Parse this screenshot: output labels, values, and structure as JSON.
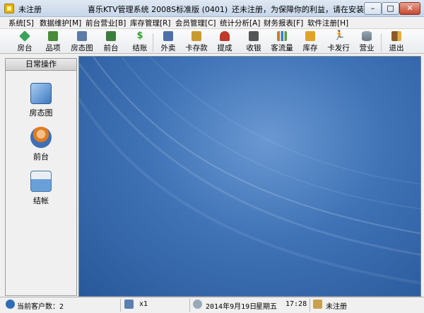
{
  "titlebar": {
    "left_text": "未注册",
    "app_title": "喜乐KTV管理系统  2008S标准版 (0401)",
    "notice": "还未注册，为保障你的利益，请在安装...",
    "min_label": "–",
    "max_label": "□",
    "close_label": "✕"
  },
  "menu": {
    "items": [
      {
        "label": "系统[S]"
      },
      {
        "label": "数据维护[M]"
      },
      {
        "label": "前台营业[B]"
      },
      {
        "label": "库存管理[R]"
      },
      {
        "label": "会员管理[C]"
      },
      {
        "label": "统计分析[A]"
      },
      {
        "label": "财务报表[F]"
      },
      {
        "label": "软件注册[H]"
      }
    ]
  },
  "toolbar": {
    "items": [
      {
        "label": "房台",
        "icon": "diamond-icon",
        "color": "#3aa35a"
      },
      {
        "label": "品项",
        "icon": "calendar-icon",
        "color": "#4a8a3a"
      },
      {
        "label": "房态图",
        "icon": "grid-icon",
        "color": "#5c7ca8"
      },
      {
        "label": "前台",
        "icon": "desk-icon",
        "color": "#3c7d3c"
      },
      {
        "label": "结账",
        "icon": "dollar-icon",
        "color": "#2e9e2e"
      },
      {
        "label": "外卖",
        "icon": "takeout-icon",
        "color": "#4e6fa8"
      },
      {
        "label": "卡存款",
        "icon": "card-deposit-icon",
        "color": "#c99a2e"
      },
      {
        "label": "提成",
        "icon": "commission-icon",
        "color": "#c0392b"
      },
      {
        "label": "收银",
        "icon": "cashier-icon",
        "color": "#555555"
      },
      {
        "label": "客流量",
        "icon": "bar-chart-icon",
        "color": "#d47a1e"
      },
      {
        "label": "库存",
        "icon": "box-icon",
        "color": "#e0a22a"
      },
      {
        "label": "卡发行",
        "icon": "runner-icon",
        "color": "#333333"
      },
      {
        "label": "营业",
        "icon": "cylinder-icon",
        "color": "#7d8b99"
      },
      {
        "label": "退出",
        "icon": "exit-door-icon",
        "color": "#8a5a2b"
      }
    ]
  },
  "left_panel": {
    "header": "日常操作",
    "items": [
      {
        "label": "房态图",
        "icon": "monitor-icon",
        "color": "#4f88c6"
      },
      {
        "label": "前台",
        "icon": "receptionist-icon",
        "color": "#e07b20"
      },
      {
        "label": "结帐",
        "icon": "printer-icon",
        "color": "#6aa0d8"
      }
    ]
  },
  "statusbar": {
    "customers": "当前客户数：2",
    "users": "x1",
    "date": "2014年9月19日",
    "weekday": "星期五",
    "time": "17:28",
    "reg_status": "未注册"
  },
  "colors": {
    "desktop_blue": "#3f73b6",
    "titlebar": "#c7d6ea"
  }
}
